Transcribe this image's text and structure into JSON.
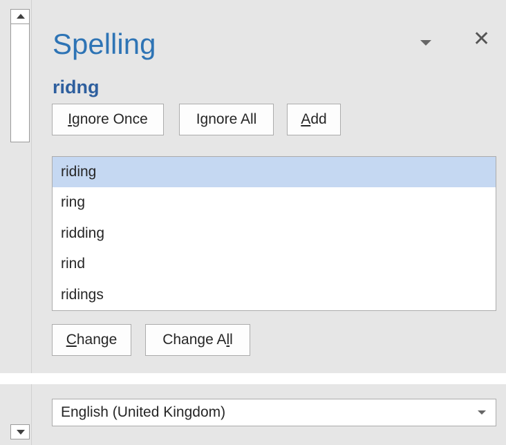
{
  "pane": {
    "title": "Spelling",
    "options_icon": "chevron-down-icon",
    "close_icon": "close-icon",
    "close_glyph": "✕"
  },
  "misspelled_word": "ridng",
  "actions": {
    "ignore_once": {
      "pre": "",
      "ul": "I",
      "post": "gnore Once"
    },
    "ignore_all": {
      "pre": "I",
      "ul": "g",
      "post": "nore All"
    },
    "add": {
      "pre": "",
      "ul": "A",
      "post": "dd"
    },
    "change": {
      "pre": "",
      "ul": "C",
      "post": "hange"
    },
    "change_all": {
      "pre": "Change A",
      "ul": "l",
      "post": "l"
    }
  },
  "suggestions": [
    {
      "label": "riding",
      "selected": true
    },
    {
      "label": "ring",
      "selected": false
    },
    {
      "label": "ridding",
      "selected": false
    },
    {
      "label": "rind",
      "selected": false
    },
    {
      "label": "ridings",
      "selected": false
    }
  ],
  "language": {
    "selected": "English (United Kingdom)"
  },
  "colors": {
    "title": "#2e74b5",
    "misspelled": "#2e5f9e",
    "selection": "#c5d8f2",
    "panel_bg": "#e6e6e6"
  }
}
